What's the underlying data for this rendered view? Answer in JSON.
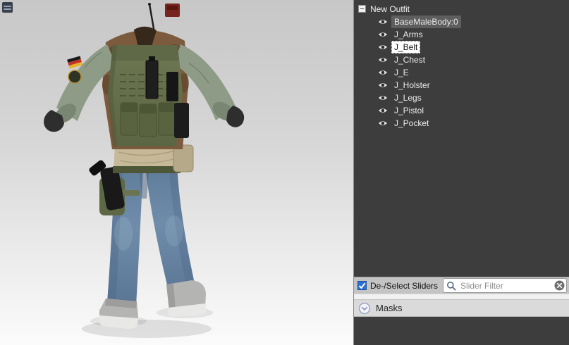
{
  "outfit_tree": {
    "root_label": "New Outfit",
    "items": [
      {
        "label": "BaseMaleBody:0",
        "visible": true,
        "state": "highlighted"
      },
      {
        "label": "J_Arms",
        "visible": true,
        "state": "normal"
      },
      {
        "label": "J_Belt",
        "visible": true,
        "state": "selected"
      },
      {
        "label": "J_Chest",
        "visible": true,
        "state": "normal"
      },
      {
        "label": "J_E",
        "visible": true,
        "state": "normal"
      },
      {
        "label": "J_Holster",
        "visible": true,
        "state": "normal"
      },
      {
        "label": "J_Legs",
        "visible": true,
        "state": "normal"
      },
      {
        "label": "J_Pistol",
        "visible": true,
        "state": "normal"
      },
      {
        "label": "J_Pocket",
        "visible": true,
        "state": "normal"
      }
    ]
  },
  "slider_bar": {
    "checkbox_label": "De-/Select Sliders",
    "checkbox_checked": true,
    "filter_placeholder": "Slider Filter",
    "filter_value": ""
  },
  "masks_section": {
    "label": "Masks"
  },
  "icons": {
    "collapse_glyph": "−",
    "tree_visibility": "eye-icon",
    "filter_search": "search-icon",
    "filter_clear": "clear-icon",
    "masks_expander": "chevron-down-icon"
  },
  "colors": {
    "tree_panel_bg": "#3d3d3d",
    "tree_text": "#ececec",
    "highlight_bg": "#5e5e5e",
    "selected_bg": "#ffffff",
    "checkbox_blue": "#2a6fd6",
    "toolbar_bg": "#c4c4c4",
    "masks_bar_bg": "#dadada",
    "viewport_top": "#c7c7c7",
    "viewport_bottom": "#fbfbfb"
  }
}
